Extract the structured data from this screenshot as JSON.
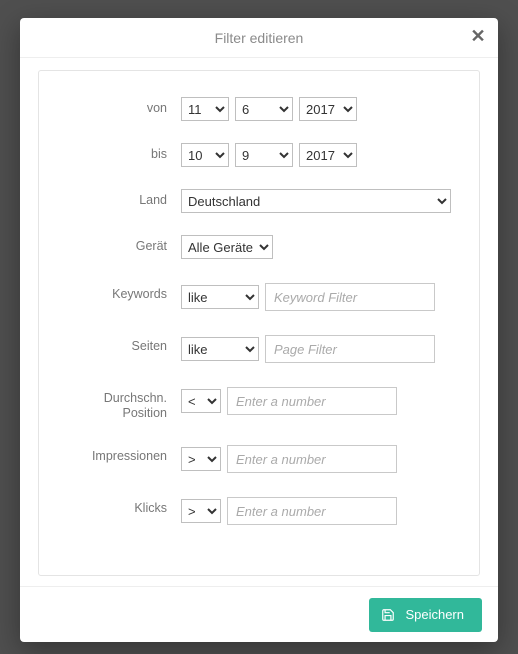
{
  "modal": {
    "title": "Filter editieren",
    "save_label": "Speichern"
  },
  "labels": {
    "from": "von",
    "to": "bis",
    "country": "Land",
    "device": "Gerät",
    "keywords": "Keywords",
    "pages": "Seiten",
    "avg_position": "Durchschn. Position",
    "impressions": "Impressionen",
    "clicks": "Klicks"
  },
  "from": {
    "day": "11",
    "month": "6",
    "year": "2017"
  },
  "to": {
    "day": "10",
    "month": "9",
    "year": "2017"
  },
  "country": {
    "value": "Deutschland"
  },
  "device": {
    "value": "Alle Geräte"
  },
  "keywords": {
    "op": "like",
    "value": "",
    "placeholder": "Keyword Filter"
  },
  "pages": {
    "op": "like",
    "value": "",
    "placeholder": "Page Filter"
  },
  "avg_position": {
    "op": "<",
    "value": "",
    "placeholder": "Enter a number"
  },
  "impressions": {
    "op": ">",
    "value": "",
    "placeholder": "Enter a number"
  },
  "clicks": {
    "op": ">",
    "value": "",
    "placeholder": "Enter a number"
  }
}
